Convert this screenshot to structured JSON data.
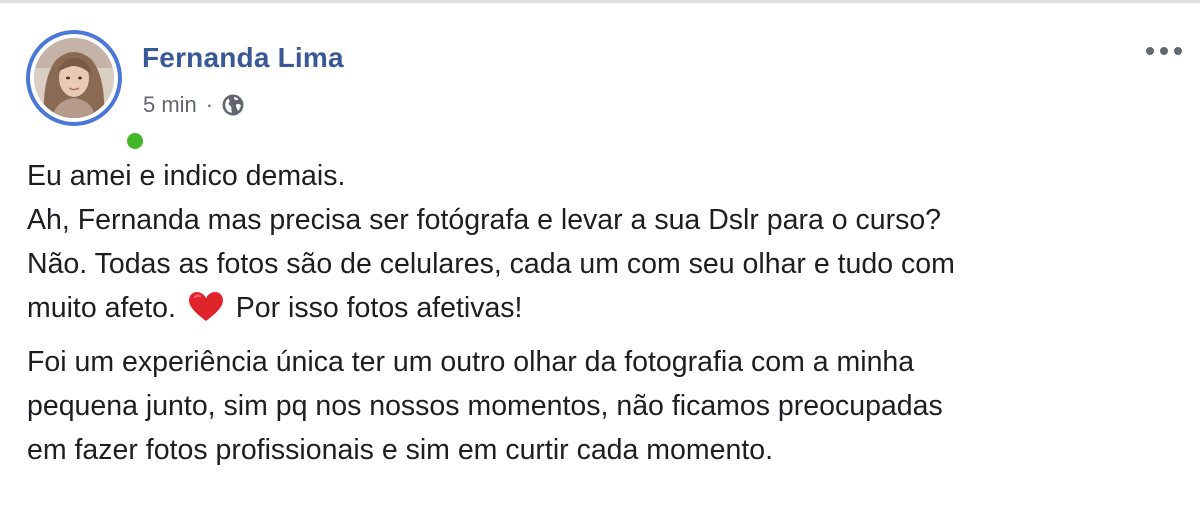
{
  "post": {
    "author": "Fernanda Lima",
    "time": "5 min",
    "separator": "·",
    "privacy_icon": "globe-icon",
    "menu_icon": "more-options-icon",
    "online_status_color": "#42b72a",
    "author_color": "#385898",
    "paragraphs": [
      {
        "lines": [
          {
            "text": "Eu amei e indico demais."
          },
          {
            "text": "Ah, Fernanda mas precisa ser fotógrafa e levar a sua Dslr para o curso?"
          },
          {
            "text": "Não. Todas as fotos são de celulares, cada um com seu olhar e tudo com"
          },
          {
            "text": "muito afeto. ",
            "emoji": "red-heart-icon",
            "after": " Por isso fotos afetivas!"
          }
        ]
      },
      {
        "lines": [
          {
            "text": "Foi um experiência única ter um outro olhar da fotografia com a minha"
          },
          {
            "text": "pequena junto, sim pq nos nossos momentos, não ficamos preocupadas"
          },
          {
            "text": "em fazer fotos profissionais e sim em curtir cada momento."
          }
        ]
      }
    ]
  }
}
